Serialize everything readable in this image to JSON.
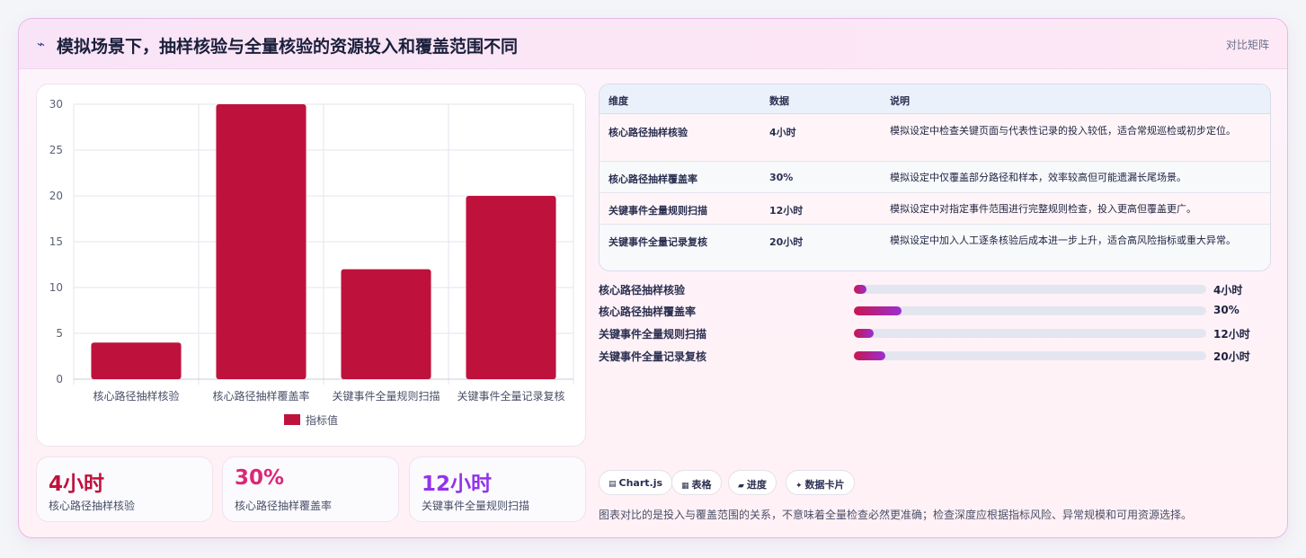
{
  "header": {
    "icon": "sparkline-icon",
    "title": "模拟场景下，抽样核验与全量核验的资源投入和覆盖范围不同",
    "tag": "对比矩阵"
  },
  "chart_data": {
    "type": "bar",
    "categories": [
      "核心路径抽样核验",
      "核心路径抽样覆盖率",
      "关键事件全量规则扫描",
      "关键事件全量记录复核"
    ],
    "series": [
      {
        "name": "指标值",
        "values": [
          4,
          30,
          12,
          20
        ],
        "color": "#be123c"
      }
    ],
    "ylim": [
      0,
      30
    ],
    "yticks": [
      0,
      5,
      10,
      15,
      20,
      25,
      30
    ],
    "grid": true,
    "legend": "bottom"
  },
  "stats": [
    {
      "value": "4小时",
      "label": "核心路径抽样核验",
      "color": "#be123c"
    },
    {
      "value": "30%",
      "label": "核心路径抽样覆盖率",
      "color": "#db2777"
    },
    {
      "value": "12小时",
      "label": "关键事件全量规则扫描",
      "color": "#9333ea"
    }
  ],
  "table": {
    "headers": [
      "维度",
      "数据",
      "说明"
    ],
    "rows": [
      {
        "dim": "核心路径抽样核验",
        "data": "4小时",
        "desc": "模拟设定中检查关键页面与代表性记录的投入较低，适合常规巡检或初步定位。"
      },
      {
        "dim": "核心路径抽样覆盖率",
        "data": "30%",
        "desc": "模拟设定中仅覆盖部分路径和样本，效率较高但可能遗漏长尾场景。"
      },
      {
        "dim": "关键事件全量规则扫描",
        "data": "12小时",
        "desc": "模拟设定中对指定事件范围进行完整规则检查，投入更高但覆盖更广。"
      },
      {
        "dim": "关键事件全量记录复核",
        "data": "20小时",
        "desc": "模拟设定中加入人工逐条核验后成本进一步上升，适合高风险指标或重大异常。"
      }
    ]
  },
  "progress": [
    {
      "label": "核心路径抽样核验",
      "value": "4小时",
      "fraction": 0.035
    },
    {
      "label": "核心路径抽样覆盖率",
      "value": "30%",
      "fraction": 0.135
    },
    {
      "label": "关键事件全量规则扫描",
      "value": "12小时",
      "fraction": 0.055
    },
    {
      "label": "关键事件全量记录复核",
      "value": "20小时",
      "fraction": 0.09
    }
  ],
  "chips": [
    {
      "icon": "chart-icon",
      "label": "Chart.js"
    },
    {
      "icon": "table-icon",
      "label": "表格"
    },
    {
      "icon": "progress-icon",
      "label": "进度"
    },
    {
      "icon": "sparkle-icon",
      "label": "数据卡片"
    }
  ],
  "note": "图表对比的是投入与覆盖范围的关系，不意味着全量检查必然更准确；检查深度应根据指标风险、异常规模和可用资源选择。"
}
